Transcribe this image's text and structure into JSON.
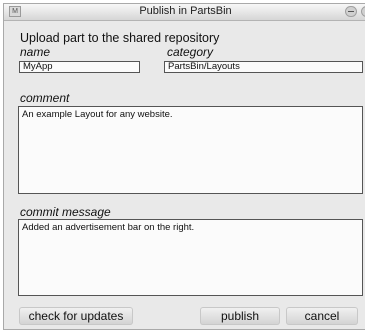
{
  "window": {
    "title": "Publish in PartsBin",
    "menu_glyph": "M"
  },
  "form": {
    "heading": "Upload part to the shared repository",
    "name_label": "name",
    "name_value": "MyApp",
    "category_label": "category",
    "category_value": "PartsBin/Layouts",
    "comment_label": "comment",
    "comment_value": "An example Layout for any website.",
    "commit_label": "commit message",
    "commit_value": "Added an advertisement bar on the right."
  },
  "buttons": {
    "check_updates": "check for updates",
    "publish": "publish",
    "cancel": "cancel"
  }
}
